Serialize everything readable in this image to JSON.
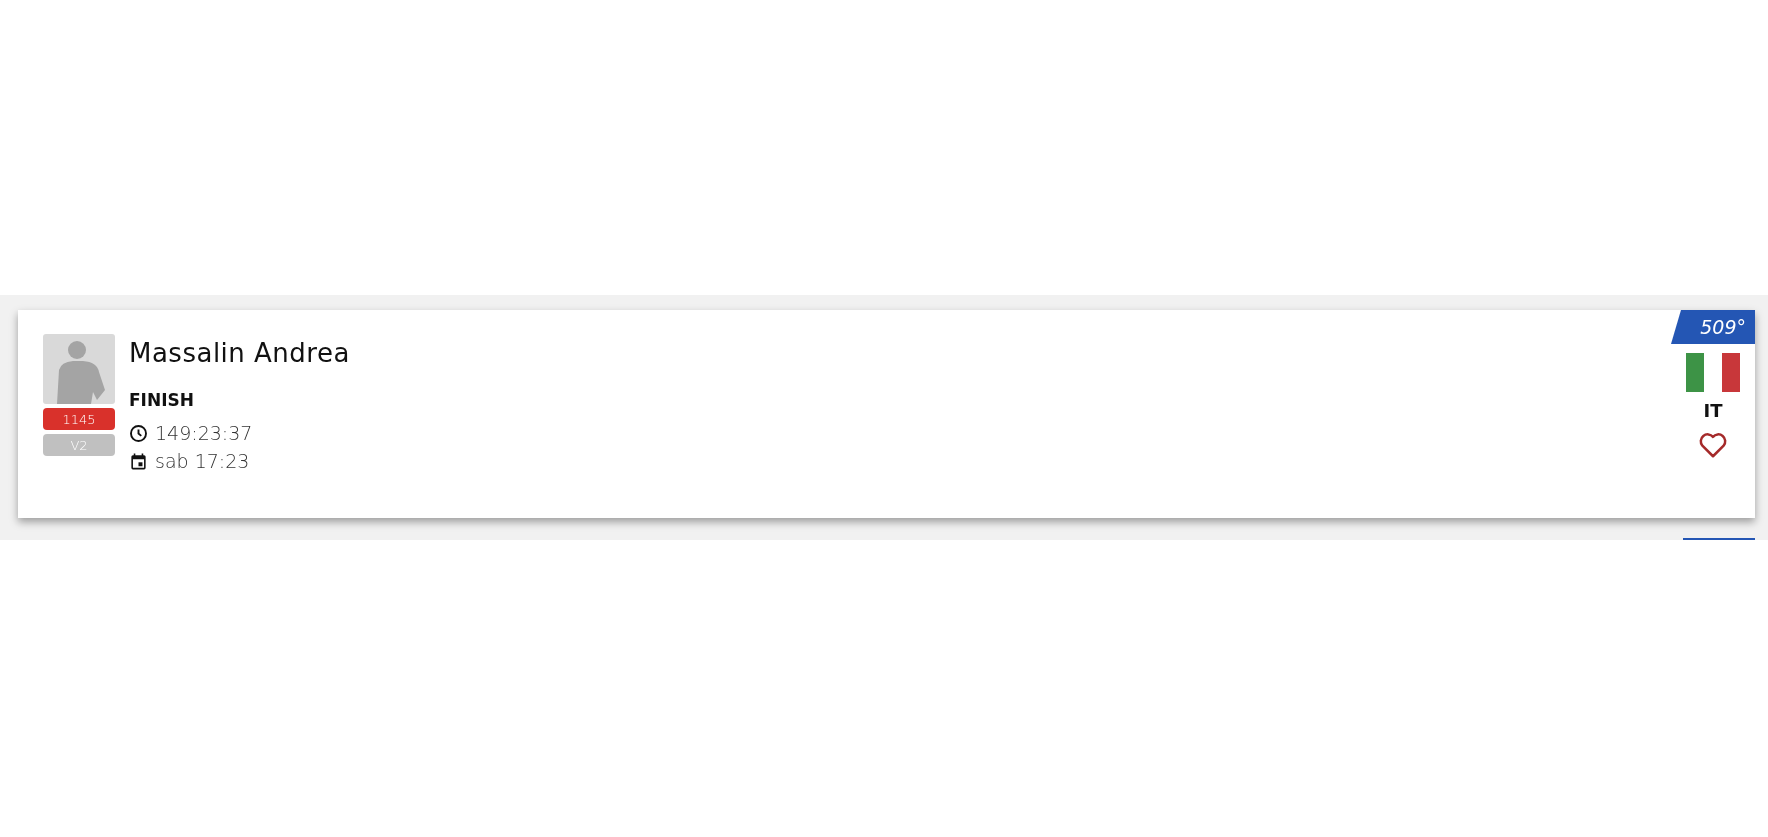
{
  "athlete": {
    "name": "Massalin Andrea",
    "bib": "1145",
    "category": "V2",
    "status": "FINISH",
    "time": "149:23:37",
    "date": "sab 17:23",
    "rank": "509°",
    "country": "IT",
    "favorite": false
  }
}
